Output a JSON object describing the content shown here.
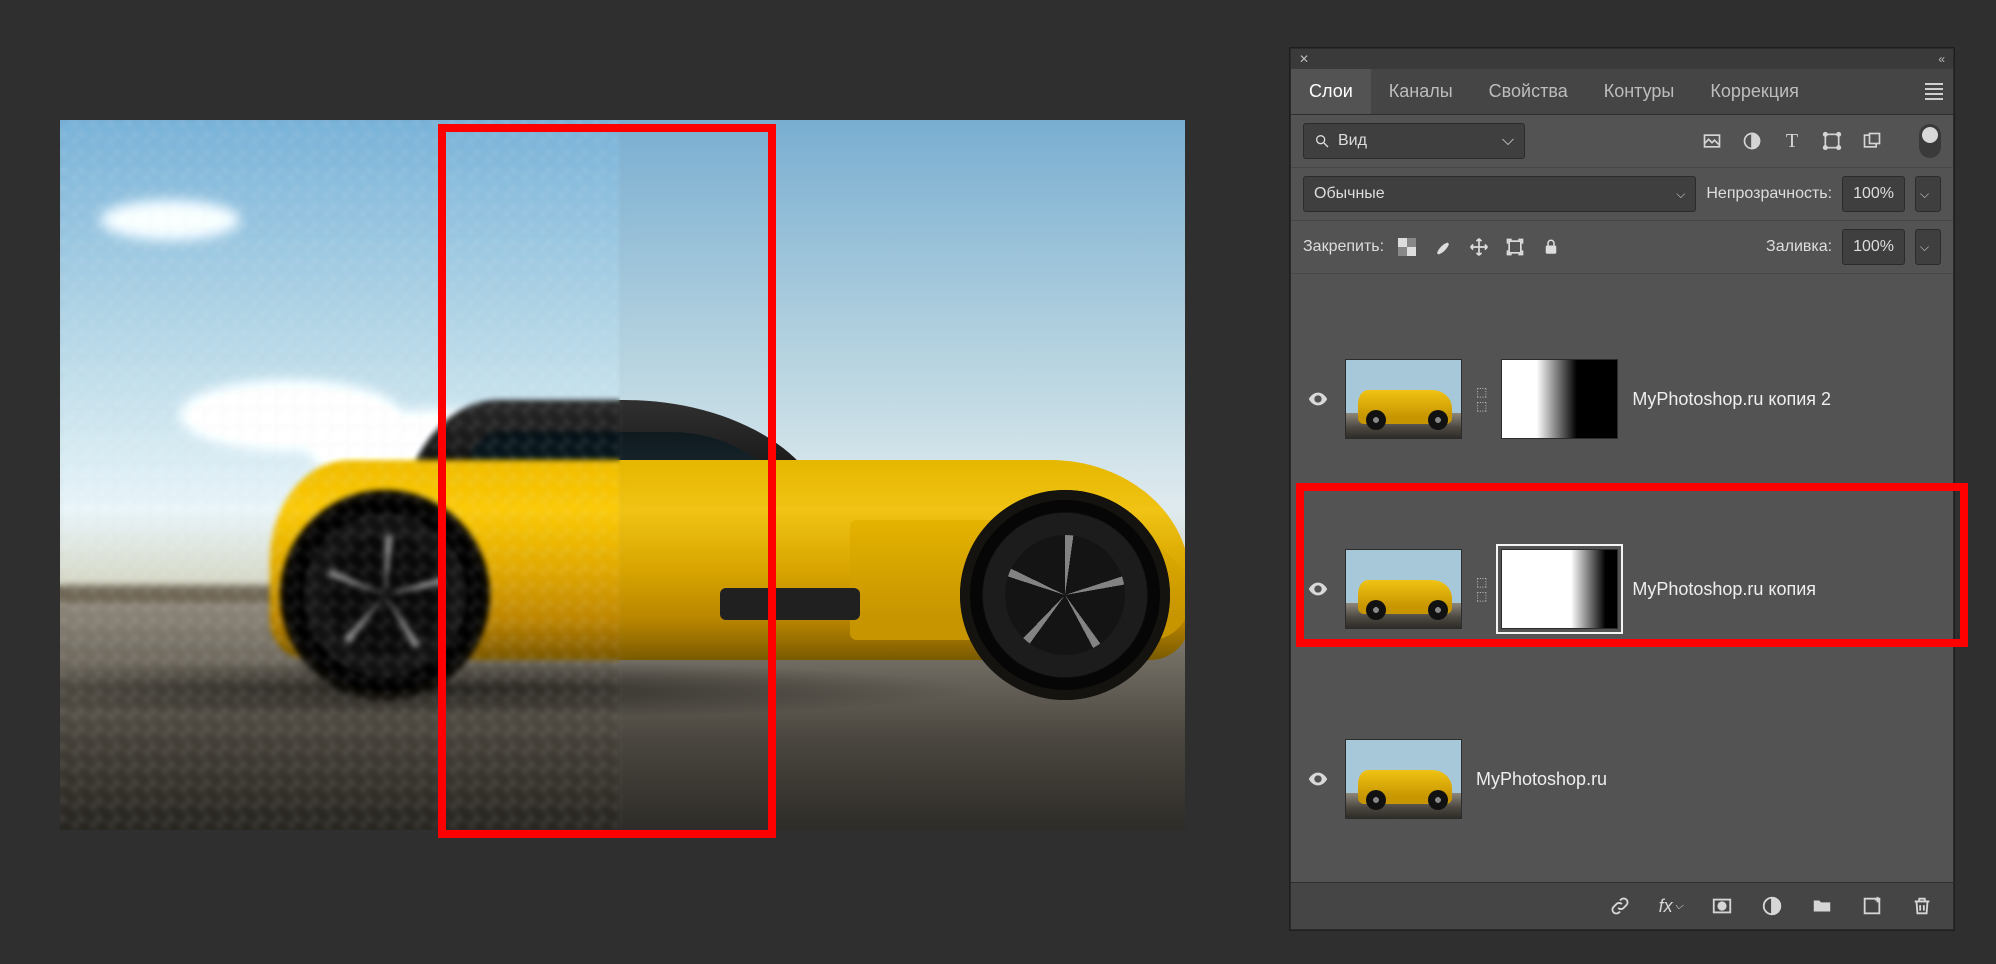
{
  "tabs": {
    "layers": "Слои",
    "channels": "Каналы",
    "properties": "Свойства",
    "paths": "Контуры",
    "adjustments": "Коррекция"
  },
  "search": {
    "label": "Вид"
  },
  "blend": {
    "mode": "Обычные",
    "opacity_label": "Непрозрачность:",
    "opacity_value": "100%"
  },
  "lock": {
    "label": "Закрепить:",
    "fill_label": "Заливка:",
    "fill_value": "100%"
  },
  "layers": [
    {
      "name": "MyPhotoshop.ru копия 2"
    },
    {
      "name": "MyPhotoshop.ru копия"
    },
    {
      "name": "MyPhotoshop.ru"
    }
  ]
}
